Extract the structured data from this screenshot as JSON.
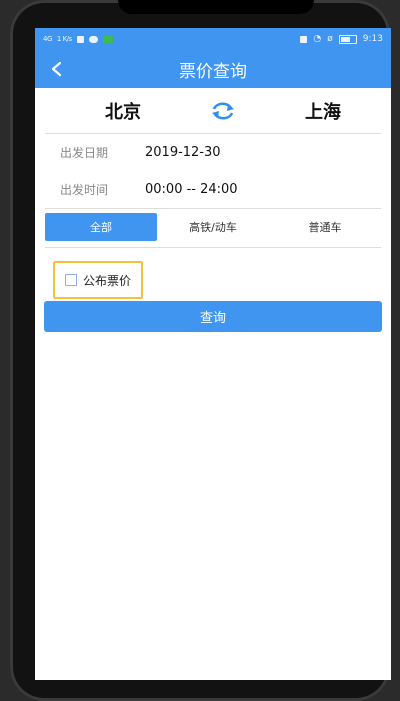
{
  "statusbar": {
    "signal": "4G",
    "speed": "1 K/s",
    "time": "9:13"
  },
  "navbar": {
    "title": "票价查询"
  },
  "route": {
    "from": "北京",
    "to": "上海"
  },
  "fields": [
    {
      "label": "出发日期",
      "value": "2019-12-30"
    },
    {
      "label": "出发时间",
      "value": "00:00 -- 24:00"
    }
  ],
  "tabs": [
    {
      "label": "全部",
      "active": true
    },
    {
      "label": "高铁/动车",
      "active": false
    },
    {
      "label": "普通车",
      "active": false
    }
  ],
  "published_price": {
    "label": "公布票价",
    "checked": false
  },
  "query_button": {
    "label": "查询"
  },
  "colors": {
    "accent": "#3f95f0",
    "highlight_border": "#f5c13b"
  }
}
